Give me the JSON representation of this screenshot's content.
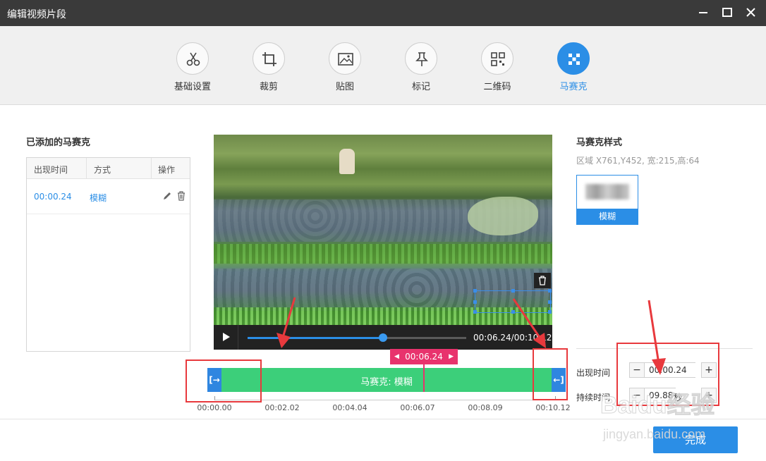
{
  "window": {
    "title": "编辑视频片段"
  },
  "toolbar": {
    "items": [
      {
        "label": "基础设置",
        "icon": "scissors-icon"
      },
      {
        "label": "裁剪",
        "icon": "crop-icon"
      },
      {
        "label": "贴图",
        "icon": "image-icon"
      },
      {
        "label": "标记",
        "icon": "pin-icon"
      },
      {
        "label": "二维码",
        "icon": "qrcode-icon"
      },
      {
        "label": "马赛克",
        "icon": "mosaic-icon",
        "active": true
      }
    ]
  },
  "mosaic_list": {
    "title": "已添加的马赛克",
    "columns": [
      "出现时间",
      "方式",
      "操作"
    ],
    "rows": [
      {
        "time": "00:00.24",
        "mode": "模糊"
      }
    ]
  },
  "player": {
    "current": "00:06.24",
    "total": "00:10.12",
    "time_display": "00:06.24/00:10.12",
    "progress": 0.62
  },
  "timeline": {
    "badge": "00:06.24",
    "clip_label": "马赛克: 模糊",
    "start_cap": "[→",
    "end_cap": "←]",
    "ticks": [
      "00:00.00",
      "00:02.02",
      "00:04.04",
      "00:06.07",
      "00:08.09",
      "00:10.12"
    ]
  },
  "style_panel": {
    "title": "马赛克样式",
    "region": "区域 X761,Y452,  宽:215,高:64",
    "style_label": "模糊"
  },
  "timing": {
    "appear_label": "出现时间",
    "appear_value": "00:00.24",
    "duration_label": "持续时间",
    "duration_value": "09.88",
    "duration_unit": "秒"
  },
  "actions": {
    "done": "完成"
  },
  "watermark": {
    "text": "Baidu经验",
    "url": "jingyan.baidu.com"
  },
  "colors": {
    "accent": "#2b8ee6",
    "clip": "#3ccf7a",
    "marker": "#e8336d",
    "annotation": "#e8393d"
  }
}
